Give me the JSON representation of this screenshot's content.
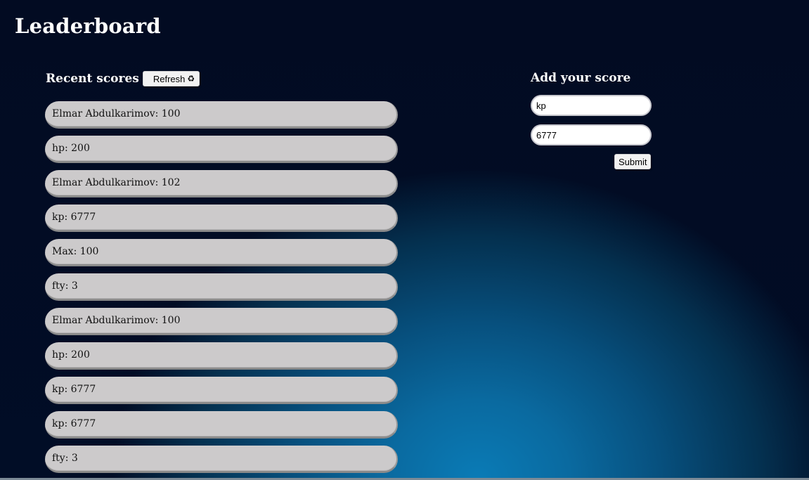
{
  "page": {
    "title": "Leaderboard"
  },
  "recent": {
    "title": "Recent scores",
    "refresh_label": "Refresh",
    "refresh_icon": "♻",
    "scores": [
      "Elmar Abdulkarimov: 100",
      "hp: 200",
      "Elmar Abdulkarimov: 102",
      "kp: 6777",
      "Max: 100",
      "fty: 3",
      "Elmar Abdulkarimov: 100",
      "hp: 200",
      "kp: 6777",
      "kp: 6777",
      "fty: 3"
    ]
  },
  "add": {
    "title": "Add your score",
    "name_value": "kp",
    "score_value": "6777",
    "submit_label": "Submit"
  },
  "colors": {
    "background": "#011027",
    "glow": "#0a7bb6",
    "score_pill": "#cccacb"
  }
}
